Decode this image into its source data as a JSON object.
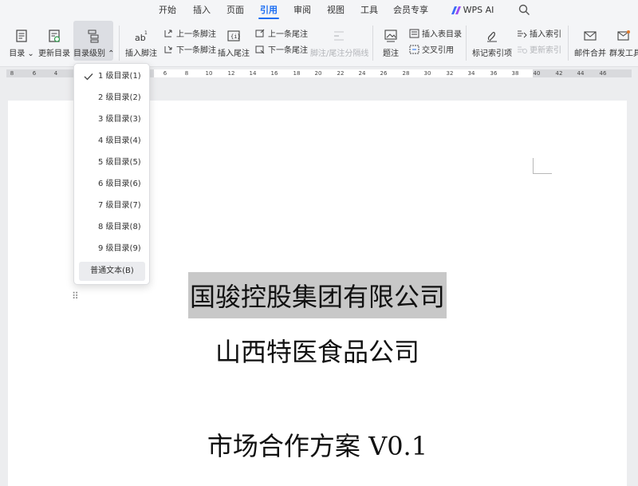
{
  "menu": {
    "tabs": [
      {
        "label": "开始",
        "active": false
      },
      {
        "label": "插入",
        "active": false
      },
      {
        "label": "页面",
        "active": false
      },
      {
        "label": "引用",
        "active": true
      },
      {
        "label": "审阅",
        "active": false
      },
      {
        "label": "视图",
        "active": false
      },
      {
        "label": "工具",
        "active": false
      },
      {
        "label": "会员专享",
        "active": false
      },
      {
        "label": "WPS AI",
        "active": false
      }
    ],
    "accent_color": "#1b6ef3",
    "search_icon": "search-icon"
  },
  "ribbon": {
    "toc": "目录",
    "update_toc": "更新目录",
    "toc_level": "目录级别",
    "insert_footnote": "插入脚注",
    "prev_footnote": "上一条脚注",
    "next_footnote": "下一条脚注",
    "insert_endnote": "插入尾注",
    "prev_endnote": "上一条尾注",
    "next_endnote": "下一条尾注",
    "note_separator": "脚注/尾注分隔线",
    "caption": "题注",
    "insert_table_of_figures": "插入表目录",
    "cross_reference": "交叉引用",
    "mark_index_entry": "标记索引项",
    "insert_index": "插入索引",
    "update_index": "更新索引",
    "mail_merge": "邮件合并",
    "bulk_tools": "群发工具"
  },
  "ruler": {
    "ticks": [
      "8",
      "6",
      "4",
      "6",
      "8",
      "10",
      "12",
      "14",
      "16",
      "18",
      "20",
      "22",
      "24",
      "26",
      "28",
      "30",
      "32",
      "34",
      "36",
      "38",
      "40",
      "42",
      "44",
      "46"
    ]
  },
  "dropdown": {
    "checked_index": 0,
    "items": [
      "1 级目录(1)",
      "2 级目录(2)",
      "3 级目录(3)",
      "4 级目录(4)",
      "5 级目录(5)",
      "6 级目录(6)",
      "7 级目录(7)",
      "8 级目录(8)",
      "9 级目录(9)"
    ],
    "plain_text": "普通文本(B)"
  },
  "document": {
    "company": "国骏控股集团有限公司",
    "subsidiary": "山西特医食品公司",
    "plan_title": "市场合作方案 V0.1"
  }
}
